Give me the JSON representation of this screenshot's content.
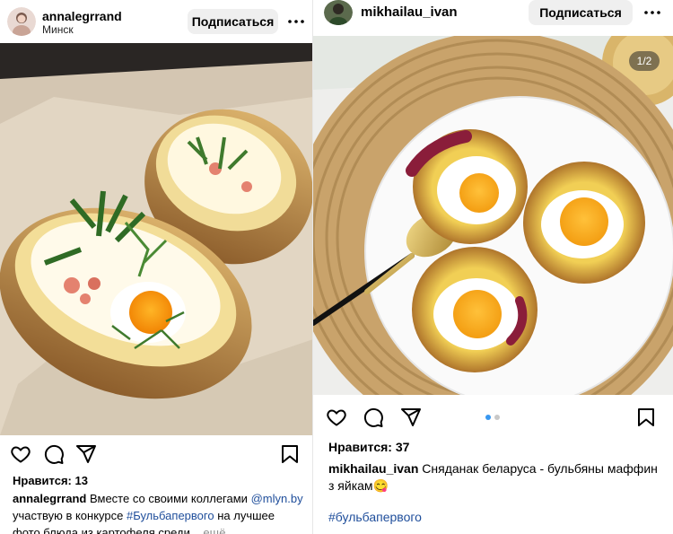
{
  "left_post": {
    "username": "annalegrrand",
    "location": "Минск",
    "follow_label": "Подписаться",
    "more_icon": "more-horizontal-icon",
    "likes_text": "Нравится: 13",
    "caption": {
      "author": "annalegrrand",
      "part1": "Вместе со своими коллегами",
      "mention": "@mlyn.by",
      "part2": "участвую в конкурсе",
      "hashtag": "#Бульбапервого",
      "part3": "на лучшее фото блюда из картофеля среди...",
      "more": "ещё"
    },
    "photo_alt": "Baked potato boats with egg, ham and dill on parchment"
  },
  "right_post": {
    "username": "mikhailau_ivan",
    "follow_label": "Подписаться",
    "more_icon": "more-horizontal-icon",
    "counter": "1/2",
    "likes_text": "Нравится: 37",
    "caption": {
      "author": "mikhailau_ivan",
      "text": "Сняданак беларуса - бульбяны маффин з яйкам😋",
      "hashtag": "#бульбапервого"
    },
    "photo_alt": "Potato muffins with fried eggs on a white plate with golden spoon"
  },
  "colors": {
    "link": "#1f4e9b",
    "carousel_active": "#3897f0",
    "button_bg": "#efefef"
  }
}
